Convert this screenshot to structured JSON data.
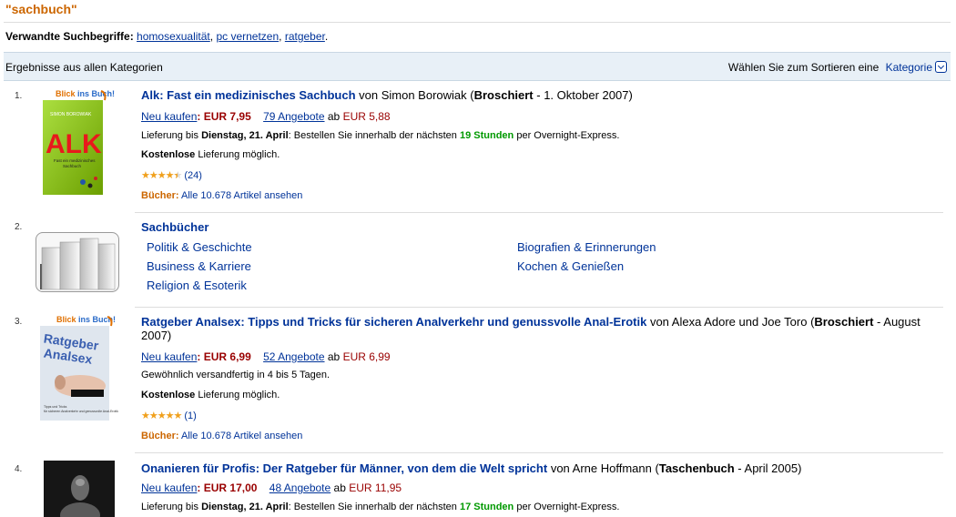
{
  "query": "\"sachbuch\"",
  "related": {
    "label": "Verwandte Suchbegriffe:",
    "terms": [
      "homosexualität",
      "pc vernetzen",
      "ratgeber"
    ]
  },
  "bar": {
    "left": "Ergebnisse aus allen Kategorien",
    "sort_label": "Wählen Sie zum Sortieren eine",
    "sort_value": "Kategorie"
  },
  "colors": {
    "link": "#003399",
    "price": "#990000",
    "orange": "#cc6600",
    "green": "#009900"
  },
  "items": [
    {
      "num": "1.",
      "badge": "Blick ins Buch!",
      "cover_word": "ALK",
      "title": "Alk: Fast ein medizinisches Sachbuch",
      "by": "von Simon Borowiak",
      "format": "Broschiert",
      "date": "1. Oktober 2007",
      "buy_label": "Neu kaufen",
      "price": "EUR 7,95",
      "offers": "79 Angebote",
      "offers_from": "ab",
      "offers_price": "EUR 5,88",
      "delivery_prefix": "Lieferung bis",
      "delivery_date": "Dienstag, 21. April",
      "delivery_mid": ": Bestellen Sie innerhalb der nächsten",
      "delivery_hours": "19 Stunden",
      "delivery_suffix": "per Overnight-Express.",
      "free_bold": "Kostenlose",
      "free_rest": "Lieferung möglich.",
      "stars": 4.5,
      "reviews": "(24)",
      "cat_label": "Bücher:",
      "cat_link": "Alle 10.678 Artikel ansehen"
    },
    {
      "num": "2.",
      "cat_title": "Sachbücher",
      "links_left": [
        "Politik & Geschichte",
        "Business & Karriere",
        "Religion & Esoterik"
      ],
      "links_right": [
        "Biografien & Erinnerungen",
        "Kochen & Genießen"
      ]
    },
    {
      "num": "3.",
      "badge": "Blick ins Buch!",
      "title": "Ratgeber Analsex: Tipps und Tricks für sicheren Analverkehr und genussvolle Anal-Erotik",
      "by": "von Alexa Adore und Joe Toro",
      "format": "Broschiert",
      "date": "August 2007",
      "buy_label": "Neu kaufen",
      "price": "EUR 6,99",
      "offers": "52 Angebote",
      "offers_from": "ab",
      "offers_price": "EUR 6,99",
      "shipping": "Gewöhnlich versandfertig in 4 bis 5 Tagen.",
      "free_bold": "Kostenlose",
      "free_rest": "Lieferung möglich.",
      "stars": 5,
      "reviews": "(1)",
      "cat_label": "Bücher:",
      "cat_link": "Alle 10.678 Artikel ansehen"
    },
    {
      "num": "4.",
      "title": "Onanieren für Profis: Der Ratgeber für Männer, von dem die Welt spricht",
      "by": "von Arne Hoffmann",
      "format": "Taschenbuch",
      "date": "April 2005",
      "buy_label": "Neu kaufen",
      "price": "EUR 17,00",
      "offers": "48 Angebote",
      "offers_from": "ab",
      "offers_price": "EUR 11,95",
      "delivery_prefix": "Lieferung bis",
      "delivery_date": "Dienstag, 21. April",
      "delivery_mid": ": Bestellen Sie innerhalb der nächsten",
      "delivery_hours": "17 Stunden",
      "delivery_suffix": "per Overnight-Express."
    }
  ]
}
